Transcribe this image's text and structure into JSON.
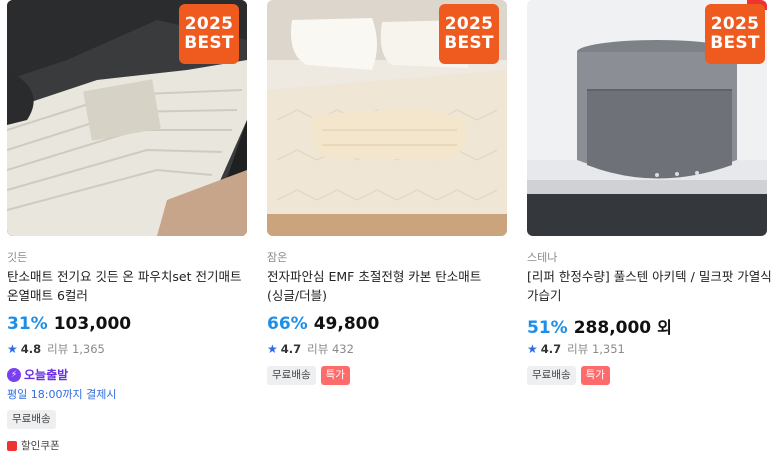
{
  "products": [
    {
      "badge": {
        "line1": "2025",
        "line2": "BEST"
      },
      "brand": "깃든",
      "title": "탄소매트 전기요 깃든 온 파우치set 전기매트 온열매트 6컬러",
      "discount": "31%",
      "price": "103,000",
      "price_suffix": "",
      "rating": "4.8",
      "review_label": "리뷰 1,365",
      "today_label": "오늘출발",
      "deadline": "평일 18:00까지 결제시",
      "tags": [
        "무료배송"
      ],
      "coupon": "할인쿠폰"
    },
    {
      "badge": {
        "line1": "2025",
        "line2": "BEST"
      },
      "brand": "잠온",
      "title": "전자파안심 EMF 초절전형 카본 탄소매트 (싱글/더블)",
      "discount": "66%",
      "price": "49,800",
      "price_suffix": "",
      "rating": "4.7",
      "review_label": "리뷰 432",
      "tags": [
        "무료배송",
        "특가"
      ]
    },
    {
      "badge": {
        "line1": "2025",
        "line2": "BEST"
      },
      "brand": "스테나",
      "title": "[리퍼 한정수량] 풀스텐 아키텍 / 밀크팟 가열식 가습기",
      "discount": "51%",
      "price": "288,000",
      "price_suffix": "외",
      "rating": "4.7",
      "review_label": "리뷰 1,351",
      "tags": [
        "무료배송",
        "특가"
      ]
    }
  ],
  "icons": {
    "star": "star-icon",
    "bolt": "lightning-icon",
    "coupon": "coupon-icon"
  },
  "colors": {
    "discount": "#1e8fe8",
    "badge": "#ef5a1f",
    "today": "#6a2fe6",
    "special_tag": "#ff6a6a"
  }
}
